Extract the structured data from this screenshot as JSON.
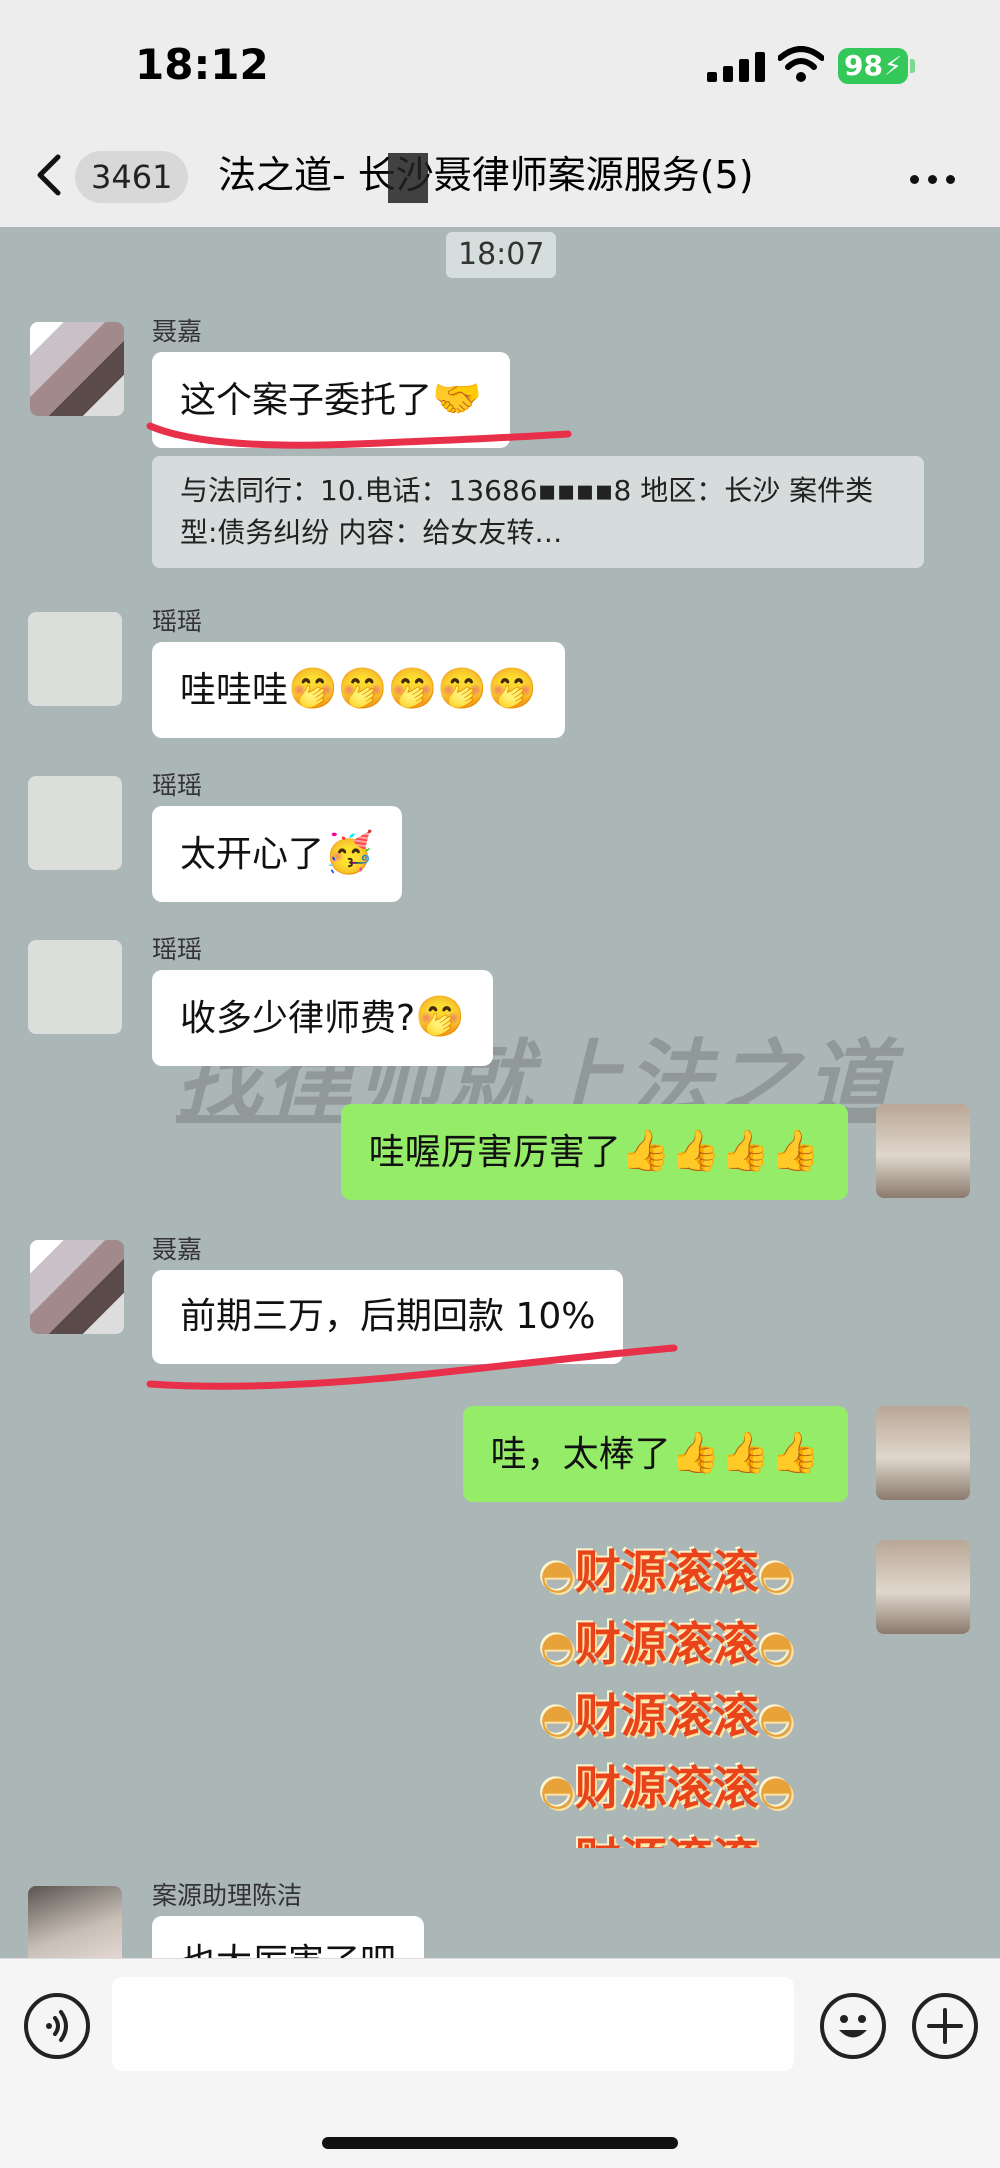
{
  "status_bar": {
    "time": "18:12",
    "battery": "98"
  },
  "header": {
    "unread_count": "3461",
    "title": "法之道-     长沙聂律师案源服务",
    "member_count": "(5)"
  },
  "watermark": "找律师就上法之道",
  "messages": [
    {
      "type": "timestamp",
      "text": "18:07"
    },
    {
      "sender": "聂嘉",
      "text": "这个案子委托了",
      "emoji": "🤝"
    },
    {
      "type": "quote",
      "text": "与法同行：10.电话：13686▪▪▪▪8 地区：长沙 案件类型:债务纠纷 内容：给女友转…"
    },
    {
      "sender": "瑶瑶",
      "text": "哇哇哇",
      "emoji": "🤭🤭🤭🤭🤭"
    },
    {
      "sender": "瑶瑶",
      "text": "太开心了",
      "emoji": "🥳"
    },
    {
      "sender": "瑶瑶",
      "text": "收多少律师费?",
      "emoji": "🤭"
    },
    {
      "sender": "me",
      "text": "哇喔厉害厉害了",
      "emoji": "👍👍👍👍"
    },
    {
      "sender": "聂嘉",
      "text": "前期三万，后期回款 10%"
    },
    {
      "sender": "me",
      "text": "哇，太棒了",
      "emoji": "👍👍👍"
    },
    {
      "sender": "me",
      "type": "sticker",
      "text": "财源滚滚"
    },
    {
      "sender": "案源助理陈洁",
      "text": "也太厉害了吧"
    }
  ],
  "colors": {
    "chat_bg": "#ABB7B7",
    "my_bubble": "#95EC69",
    "other_bubble": "#FFFFFF",
    "underline": "#E8304A"
  },
  "icons": [
    "back-chevron-icon",
    "more-dots-icon",
    "voice-icon",
    "emoji-icon",
    "plus-icon"
  ]
}
